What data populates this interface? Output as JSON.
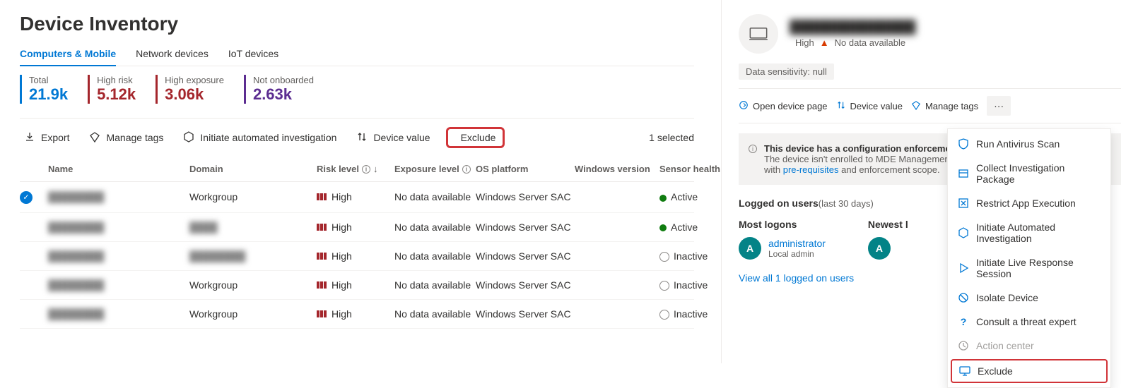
{
  "page": {
    "title": "Device Inventory"
  },
  "tabs": [
    {
      "label": "Computers & Mobile",
      "active": true
    },
    {
      "label": "Network devices",
      "active": false
    },
    {
      "label": "IoT devices",
      "active": false
    }
  ],
  "stats": [
    {
      "label": "Total",
      "value": "21.9k",
      "color": "blue"
    },
    {
      "label": "High risk",
      "value": "5.12k",
      "color": "red"
    },
    {
      "label": "High exposure",
      "value": "3.06k",
      "color": "red"
    },
    {
      "label": "Not onboarded",
      "value": "2.63k",
      "color": "purple"
    }
  ],
  "toolbar": {
    "export": "Export",
    "manage_tags": "Manage tags",
    "initiate": "Initiate automated investigation",
    "device_value": "Device value",
    "exclude": "Exclude",
    "selected": "1 selected"
  },
  "columns": {
    "name": "Name",
    "domain": "Domain",
    "risk": "Risk level",
    "exposure": "Exposure level",
    "os": "OS platform",
    "winver": "Windows version",
    "sensor": "Sensor health s"
  },
  "rows": [
    {
      "name": "████████",
      "domain": "Workgroup",
      "risk": "High",
      "exposure": "No data available",
      "os": "Windows Server SAC",
      "winver": "",
      "sensor": "Active",
      "sensor_state": "active",
      "selected": true
    },
    {
      "name": "████████",
      "domain": "████",
      "risk": "High",
      "exposure": "No data available",
      "os": "Windows Server SAC",
      "winver": "",
      "sensor": "Active",
      "sensor_state": "active",
      "selected": false
    },
    {
      "name": "████████",
      "domain": "████████",
      "risk": "High",
      "exposure": "No data available",
      "os": "Windows Server SAC",
      "winver": "",
      "sensor": "Inactive",
      "sensor_state": "inactive",
      "selected": false
    },
    {
      "name": "████████",
      "domain": "Workgroup",
      "risk": "High",
      "exposure": "No data available",
      "os": "Windows Server SAC",
      "winver": "",
      "sensor": "Inactive",
      "sensor_state": "inactive",
      "selected": false
    },
    {
      "name": "████████",
      "domain": "Workgroup",
      "risk": "High",
      "exposure": "No data available",
      "os": "Windows Server SAC",
      "winver": "",
      "sensor": "Inactive",
      "sensor_state": "inactive",
      "selected": false
    }
  ],
  "panel": {
    "device_name": "██████████████",
    "risk_label": "High",
    "no_data": "No data available",
    "sensitivity": "Data sensitivity: null",
    "open_page": "Open device page",
    "device_value": "Device value",
    "manage_tags": "Manage tags",
    "banner_title": "This device has a configuration enforcement",
    "banner_body_1": "The device isn't enrolled to MDE Management",
    "banner_body_2": "with ",
    "banner_link": "pre-requisites",
    "banner_body_3": " and enforcement scope.",
    "logged_title": "Logged on users",
    "logged_sub": "(last 30 days)",
    "most": "Most logons",
    "newest": "Newest l",
    "user_name": "administrator",
    "user_role": "Local admin",
    "avatar_initial": "A",
    "view_all": "View all 1 logged on users"
  },
  "menu": {
    "items": [
      {
        "icon": "shield",
        "label": "Run Antivirus Scan"
      },
      {
        "icon": "package",
        "label": "Collect Investigation Package"
      },
      {
        "icon": "restrict",
        "label": "Restrict App Execution"
      },
      {
        "icon": "hex",
        "label": "Initiate Automated Investigation"
      },
      {
        "icon": "play",
        "label": "Initiate Live Response Session"
      },
      {
        "icon": "isolate",
        "label": "Isolate Device"
      },
      {
        "icon": "q",
        "label": "Consult a threat expert"
      },
      {
        "icon": "clock",
        "label": "Action center",
        "disabled": true
      },
      {
        "icon": "exclude",
        "label": "Exclude",
        "highlight": true
      }
    ]
  }
}
